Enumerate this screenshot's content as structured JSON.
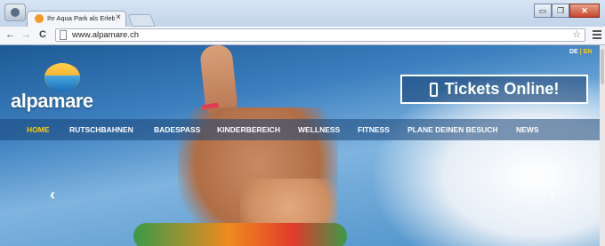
{
  "browser": {
    "tab_title": "Ihr Aqua Park als Erlebnis",
    "tab_close": "×",
    "url": "www.alpamare.ch",
    "back_icon": "←",
    "forward_icon": "→",
    "reload_icon": "C",
    "star_icon": "☆",
    "window_buttons": {
      "minimize": "▭",
      "restore": "❐",
      "close": "✕"
    }
  },
  "site": {
    "lang_de": "DE",
    "lang_sep": "|",
    "lang_en": "EN",
    "logo_text": "alpamare",
    "tickets_label": "Tickets Online!",
    "nav": [
      {
        "label": "HOME"
      },
      {
        "label": "RUTSCHBAHNEN"
      },
      {
        "label": "BADESPASS"
      },
      {
        "label": "KINDERBEREICH"
      },
      {
        "label": "WELLNESS"
      },
      {
        "label": "FITNESS"
      },
      {
        "label": "PLANE DEINEN BESUCH"
      },
      {
        "label": "NEWS"
      }
    ],
    "arrow_prev": "‹",
    "arrow_next": "›",
    "colors": {
      "accent": "#ffcc00",
      "brand_blue": "#1a6fb5"
    }
  }
}
